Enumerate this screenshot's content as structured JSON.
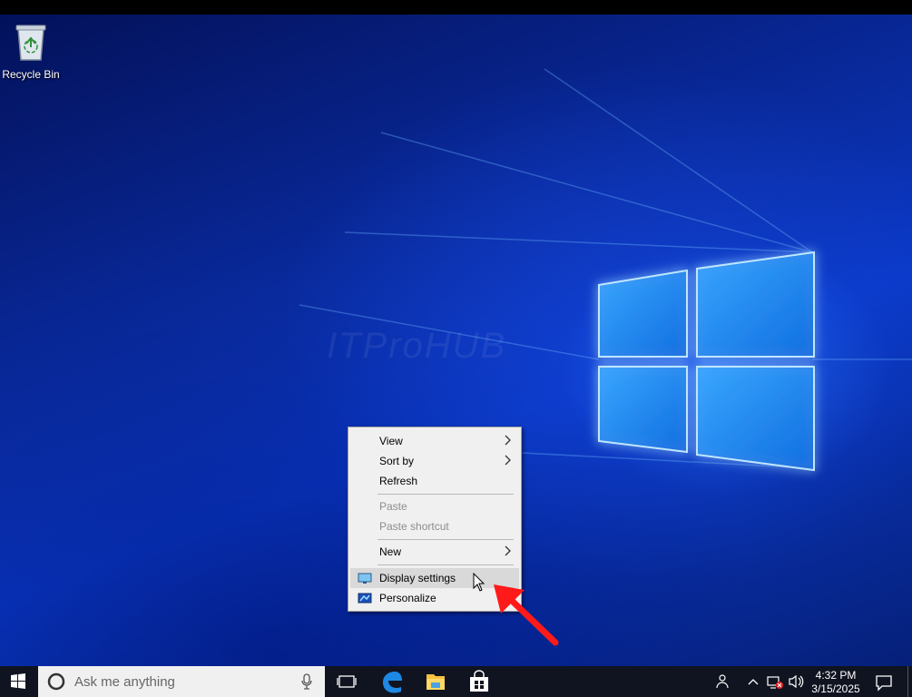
{
  "desktop": {
    "icons": [
      {
        "label": "Recycle Bin",
        "icon": "recycle-bin-icon"
      }
    ],
    "wallpaper_watermark": "ITProHUB"
  },
  "context_menu": {
    "items": [
      {
        "label": "View",
        "submenu": true,
        "disabled": false
      },
      {
        "label": "Sort by",
        "submenu": true,
        "disabled": false
      },
      {
        "label": "Refresh",
        "submenu": false,
        "disabled": false
      },
      {
        "label": "Paste",
        "submenu": false,
        "disabled": true
      },
      {
        "label": "Paste shortcut",
        "submenu": false,
        "disabled": true
      },
      {
        "label": "New",
        "submenu": true,
        "disabled": false
      },
      {
        "label": "Display settings",
        "submenu": false,
        "disabled": false,
        "icon": "display-icon",
        "highlighted": true
      },
      {
        "label": "Personalize",
        "submenu": false,
        "disabled": false,
        "icon": "personalize-icon"
      }
    ],
    "submenu_glyph": "›"
  },
  "taskbar": {
    "search_placeholder": "Ask me anything",
    "pinned": [
      "task-view-icon",
      "edge-icon",
      "file-explorer-icon",
      "store-icon"
    ],
    "tray_icons": [
      "people-icon",
      "chevron-up-icon",
      "network-disconnected-icon",
      "volume-icon",
      "action-center-icon"
    ],
    "clock": {
      "time": "4:32 PM",
      "date": "3/15/2025"
    }
  },
  "colors": {
    "desktop_blue": "#0a39c8",
    "taskbar": "#101420",
    "menu_bg": "#f0f0f0",
    "accent_arrow": "#ff0000"
  }
}
